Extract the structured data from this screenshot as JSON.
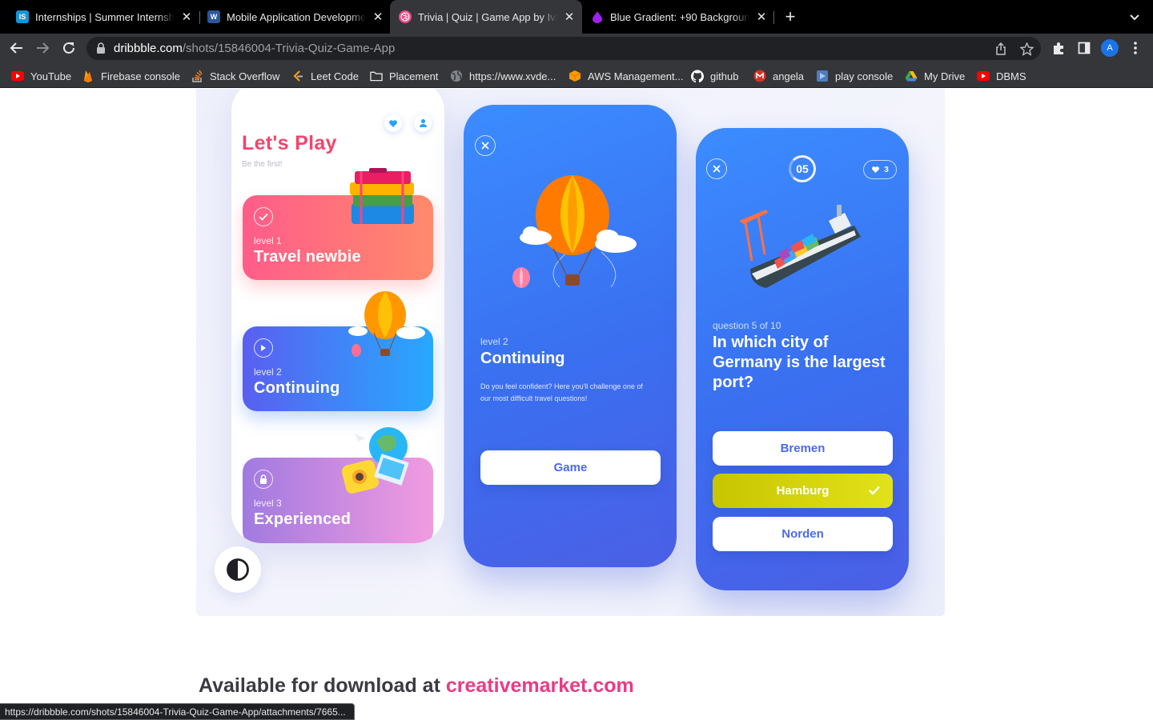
{
  "browser": {
    "tabs": [
      {
        "title": "Internships | Summer Internship",
        "icon": "internshala-icon",
        "color": "#1295d8",
        "glyph": "IS",
        "active": false
      },
      {
        "title": "Mobile Application Development",
        "icon": "word-icon",
        "color": "#2b579a",
        "glyph": "W",
        "active": false
      },
      {
        "title": "Trivia | Quiz | Game App by Ivan",
        "icon": "dribbble-icon",
        "color": "#ea4c89",
        "glyph": "",
        "active": true
      },
      {
        "title": "Blue Gradient: +90 Backgrounds",
        "icon": "drop-icon",
        "color": "#a020f0",
        "glyph": "",
        "active": false
      }
    ],
    "url_host": "dribbble.com",
    "url_path": "/shots/15846004-Trivia-Quiz-Game-App",
    "profile_initial": "A",
    "bookmarks": [
      {
        "label": "YouTube",
        "icon": "youtube-icon",
        "color": "#ff0000"
      },
      {
        "label": "Firebase console",
        "icon": "firebase-icon",
        "color": "#ffa000"
      },
      {
        "label": "Stack Overflow",
        "icon": "stackoverflow-icon",
        "color": "#f48024"
      },
      {
        "label": "Leet Code",
        "icon": "leetcode-icon",
        "color": "#ffa116"
      },
      {
        "label": "Placement",
        "icon": "folder-icon",
        "color": "#e8e8e8"
      },
      {
        "label": "https://www.xvde...",
        "icon": "globe-icon",
        "color": "#9aa0a6"
      },
      {
        "label": "AWS Management...",
        "icon": "aws-icon",
        "color": "#ff9900"
      },
      {
        "label": "github",
        "icon": "github-icon",
        "color": "#ffffff"
      },
      {
        "label": "angela",
        "icon": "gmail-icon",
        "color": "#d93025"
      },
      {
        "label": "play console",
        "icon": "playconsole-icon",
        "color": "#4f7cc2"
      },
      {
        "label": "My Drive",
        "icon": "drive-icon",
        "color": "#34a853"
      },
      {
        "label": "DBMS",
        "icon": "youtube-icon",
        "color": "#ff0000"
      }
    ],
    "status_url": "https://dribbble.com/shots/15846004-Trivia-Quiz-Game-App/attachments/7665..."
  },
  "shot": {
    "phone1": {
      "title": "Let's Play",
      "subtitle": "Be the first!",
      "levels": [
        {
          "level": "level 1",
          "name": "Travel newbie",
          "icon": "check-icon"
        },
        {
          "level": "level 2",
          "name": "Continuing",
          "icon": "play-icon"
        },
        {
          "level": "level 3",
          "name": "Experienced",
          "icon": "lock-icon"
        }
      ]
    },
    "phone2": {
      "level": "level 2",
      "name": "Continuing",
      "description": "Do you feel confident? Here you'll challenge one of our most difficult travel questions!",
      "button": "Game"
    },
    "phone3": {
      "timer": "05",
      "lives": "3",
      "question_count": "question 5 of 10",
      "question": "In which city of Germany is the largest port?",
      "answers": [
        "Bremen",
        "Hamburg",
        "Norden"
      ],
      "correct_color": "#d4d40f"
    }
  },
  "promo": {
    "prefix": "Available for download at",
    "link": "creativemarket.com",
    "link_color": "#ea3a85"
  }
}
